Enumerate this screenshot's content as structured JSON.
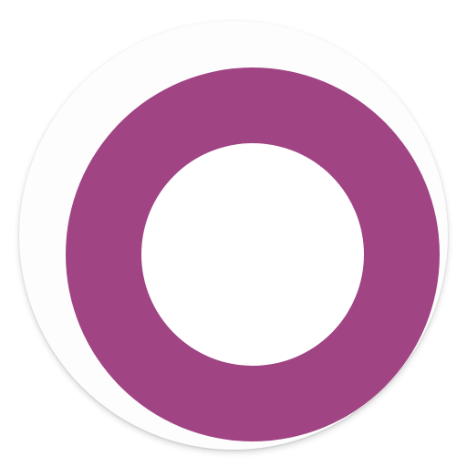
{
  "icon": {
    "name": "ring-logo-icon",
    "colors": {
      "ring": "#a04484",
      "badge": "#fdfdfd",
      "center": "#ffffff",
      "background": "#ffffff"
    }
  }
}
